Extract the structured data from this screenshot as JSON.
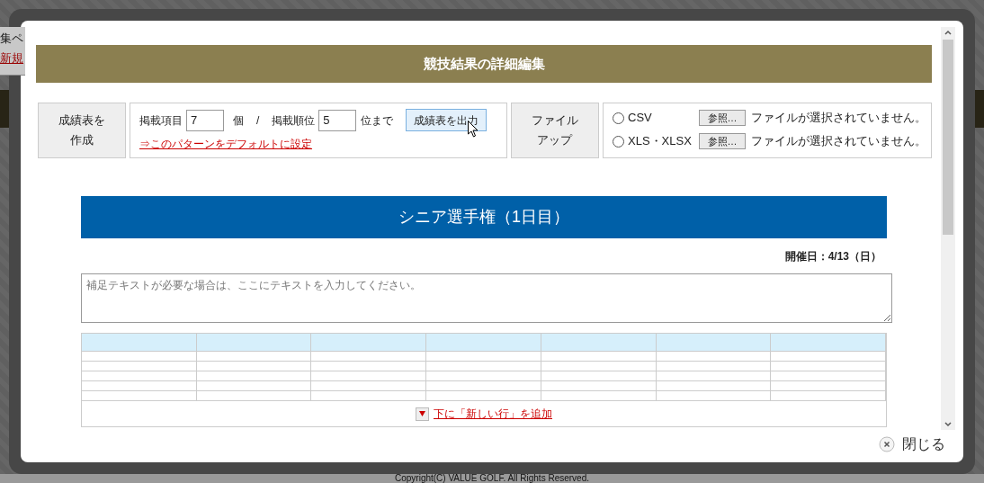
{
  "background_page": {
    "heading": "集ペ",
    "link": "新規",
    "footer": "Copyright(C) VALUE GOLF. All Rights Reserved."
  },
  "dialog": {
    "title": "競技結果の詳細編集",
    "create_section": {
      "label": "成績表を作成",
      "items_label": "掲載項目",
      "items_value": "7",
      "items_unit": "個",
      "separator": "/",
      "rank_label": "掲載順位",
      "rank_value": "5",
      "rank_unit": "位まで",
      "output_button": "成績表を出力",
      "default_link": "⇒このパターンをデフォルトに設定"
    },
    "upload_section": {
      "label": "ファイルアップ",
      "options": [
        {
          "label": "CSV",
          "selected": false,
          "browse_button": "参照…",
          "file_status": "ファイルが選択されていません。"
        },
        {
          "label": "XLS・XLSX",
          "selected": false,
          "browse_button": "参照…",
          "file_status": "ファイルが選択されていません。"
        }
      ]
    },
    "event": {
      "title": "シニア選手権（1日目）",
      "date": "開催日：4/13（日）",
      "note_placeholder": "補足テキストが必要な場合は、ここにテキストを入力してください。",
      "add_row_link": "下に「新しい行」を追加"
    },
    "close": "閉じる"
  }
}
